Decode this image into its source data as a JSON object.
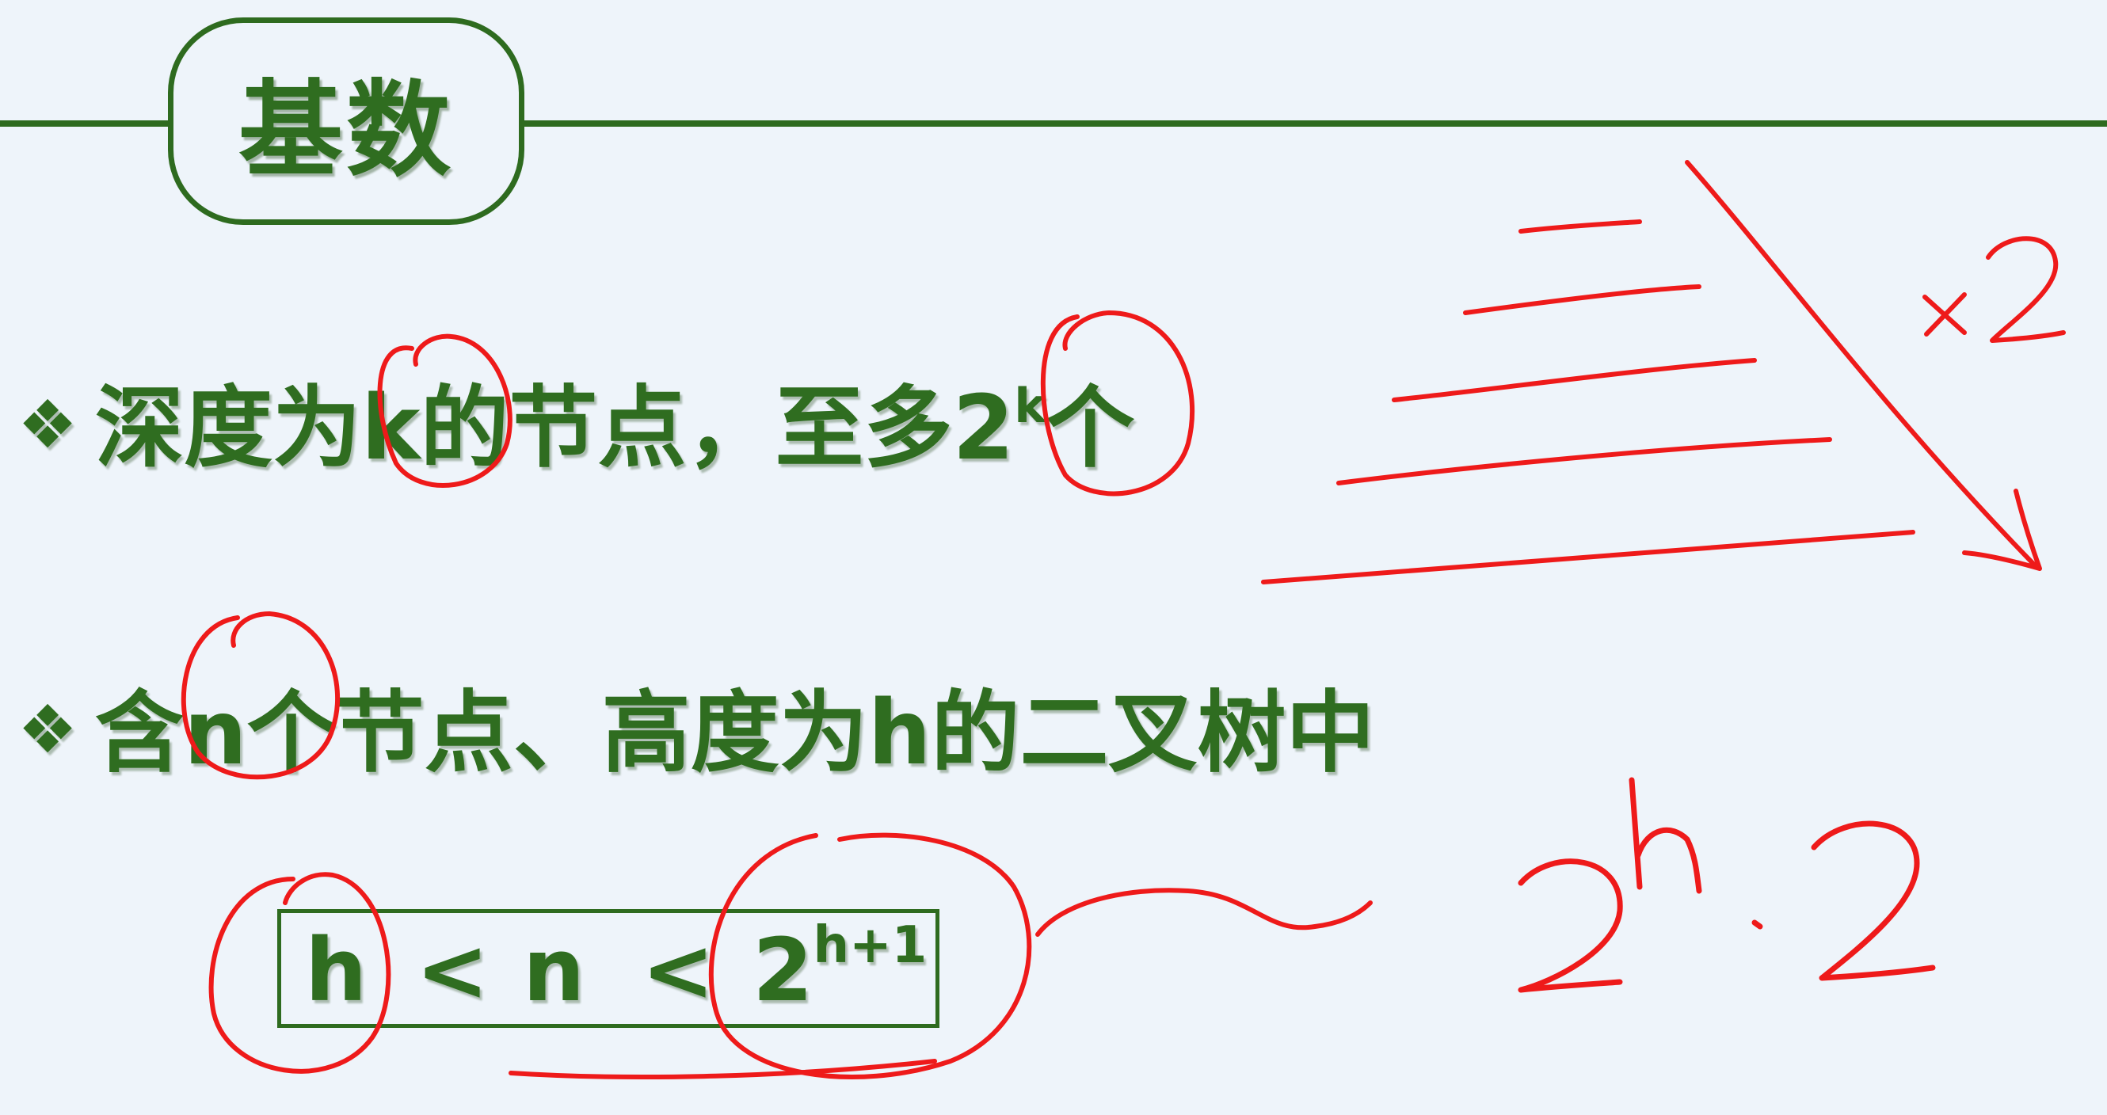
{
  "title": "基数",
  "bullets": [
    {
      "marker": "❖",
      "pre": "深度为",
      "var": "k",
      "mid": "的节点，至多",
      "base": "2",
      "exp": "k",
      "post": "个"
    },
    {
      "marker": "❖",
      "pre": "含",
      "var": "n",
      "post": "个节点、高度为h的二叉树中"
    }
  ],
  "formula": {
    "left": "h",
    "op1": "<",
    "middle": "n",
    "op2": "<",
    "base": "2",
    "exp": "h+1"
  },
  "annotations": {
    "times_label": "×2",
    "power_base": "2",
    "power_exp": "h",
    "power_dot": "·",
    "power_factor": "2",
    "ink_color": "#ee1a1a"
  }
}
